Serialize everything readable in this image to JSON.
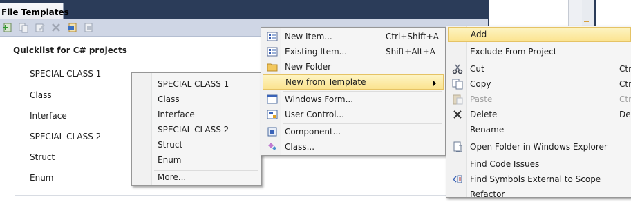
{
  "panel": {
    "tab_title": "File Templates",
    "quicklist_title": "Quicklist for C# projects",
    "items": [
      "SPECIAL CLASS 1",
      "Class",
      "Interface",
      "SPECIAL CLASS 2",
      "Struct",
      "Enum"
    ]
  },
  "toolbar": {
    "icons": [
      "add-template-icon",
      "copy-icon",
      "edit-icon",
      "delete-icon",
      "import-icon",
      "export-icon"
    ]
  },
  "templates_menu": {
    "items": [
      "SPECIAL CLASS 1",
      "Class",
      "Interface",
      "SPECIAL CLASS 2",
      "Struct",
      "Enum"
    ],
    "more": "More..."
  },
  "add_menu": {
    "items": [
      {
        "label": "New Item...",
        "shortcut": "Ctrl+Shift+A",
        "icon": "new-item-icon"
      },
      {
        "label": "Existing Item...",
        "shortcut": "Shift+Alt+A",
        "icon": "existing-item-icon"
      },
      {
        "label": "New Folder",
        "shortcut": "",
        "icon": "folder-icon"
      },
      {
        "label": "New from Template",
        "shortcut": "",
        "icon": ""
      },
      {
        "label": "Windows Form...",
        "shortcut": "",
        "icon": "windows-form-icon"
      },
      {
        "label": "User Control...",
        "shortcut": "",
        "icon": "user-control-icon"
      },
      {
        "label": "Component...",
        "shortcut": "",
        "icon": "component-icon"
      },
      {
        "label": "Class...",
        "shortcut": "",
        "icon": "class-icon"
      }
    ]
  },
  "context_menu": {
    "items": [
      {
        "label": "Add",
        "shortcut": "",
        "icon": ""
      },
      {
        "label": "Exclude From Project",
        "shortcut": "",
        "icon": ""
      },
      {
        "label": "Cut",
        "shortcut": "Ctrl",
        "icon": "scissors-icon"
      },
      {
        "label": "Copy",
        "shortcut": "Ctrl",
        "icon": "copy-icon"
      },
      {
        "label": "Paste",
        "shortcut": "Ctrl",
        "icon": "paste-icon",
        "disabled": true
      },
      {
        "label": "Delete",
        "shortcut": "Del",
        "icon": "delete-x-icon"
      },
      {
        "label": "Rename",
        "shortcut": "",
        "icon": ""
      },
      {
        "label": "Open Folder in Windows Explorer",
        "shortcut": "",
        "icon": "open-folder-icon"
      },
      {
        "label": "Find Code Issues",
        "shortcut": "",
        "icon": ""
      },
      {
        "label": "Find Symbols External to Scope",
        "shortcut": "",
        "icon": "find-symbols-icon"
      },
      {
        "label": "Refactor",
        "shortcut": "",
        "icon": ""
      }
    ]
  },
  "colors": {
    "titlebar": "#2b3c59",
    "toolbar": "#cfd6e5",
    "highlight": "#fbe38f",
    "menu_bg": "#f5f5f5"
  }
}
